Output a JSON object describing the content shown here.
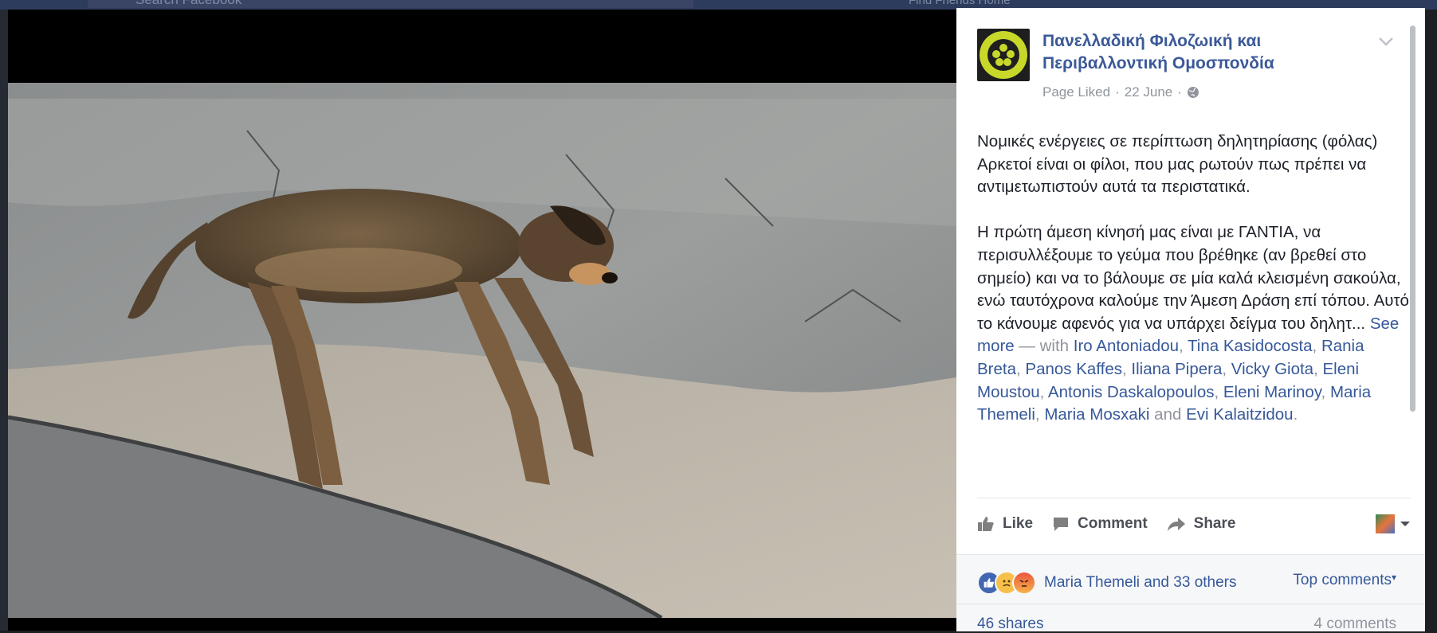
{
  "topbar": {
    "search_placeholder": "Search Facebook",
    "right_text": "Find Friends   Home"
  },
  "photo": {
    "description_icon": "dead-dog-photo"
  },
  "post": {
    "page_name": "Πανελλαδική Φιλοζωική και Περιβαλλοντική Ομοσπονδία",
    "status": "Page Liked",
    "date": "22 June",
    "privacy_icon": "globe-icon",
    "text_line1": "Νομικές ενέργειες σε περίπτωση δηλητηρίασης (φόλας)",
    "text_line2": "Αρκετοί είναι οι φίλοι, που μας ρωτούν πως πρέπει να αντιμετωπιστούν αυτά τα περιστατικά.",
    "text_para2": "Η πρώτη άμεση κίνησή μας είναι με ΓΑΝΤΙΑ, να περισυλλέξουμε το γεύμα που βρέθηκε (αν βρεθεί στο σημείο) και να το βάλουμε σε μία καλά κλεισμένη σακούλα, ενώ ταυτόχρονα καλούμε την Άμεση Δράση επί τόπου. Αυτό το κάνουμε αφενός για να υπάρχει δείγμα του δηλητ...",
    "see_more": "See more",
    "with_text": "— with",
    "tagged": [
      "Iro Antoniadou",
      "Tina Kasidocosta",
      "Rania Breta",
      "Panos Kaffes",
      "Iliana Pipera",
      "Vicky Giota",
      "Eleni Moustou",
      "Antonis Daskalopoulos",
      "Eleni Marinoy",
      "Maria Themeli",
      "Maria Mosxaki",
      "Evi Kalaitzidou"
    ],
    "and_text": "and"
  },
  "actions": {
    "like": "Like",
    "comment": "Comment",
    "share": "Share"
  },
  "stats": {
    "reactors": "Maria Themeli and 33 others",
    "top_comments": "Top comments",
    "shares": "46 shares",
    "comments": "4 comments"
  },
  "colors": {
    "link": "#365899",
    "page_name": "#3b5998",
    "muted": "#90949c",
    "like_blue": "#4267b2"
  }
}
